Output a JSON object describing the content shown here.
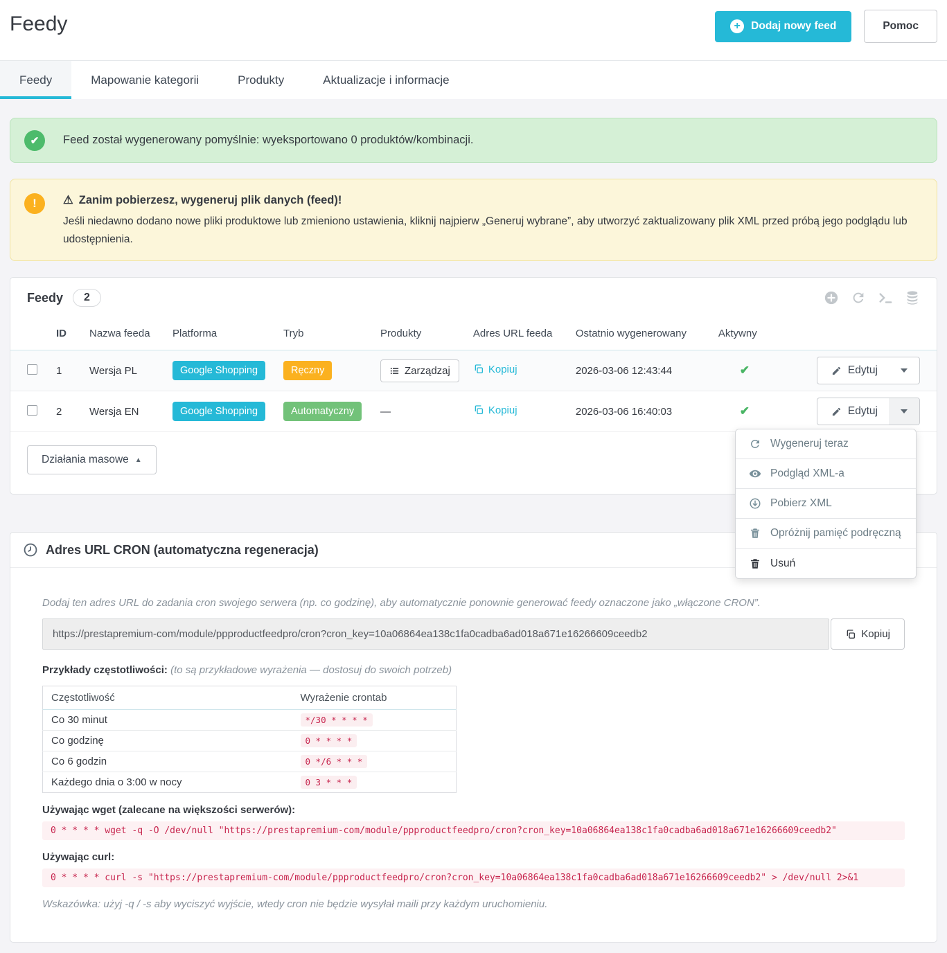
{
  "header": {
    "title": "Feedy",
    "add_button": "Dodaj nowy feed",
    "help_button": "Pomoc"
  },
  "tabs": [
    {
      "label": "Feedy"
    },
    {
      "label": "Mapowanie kategorii"
    },
    {
      "label": "Produkty"
    },
    {
      "label": "Aktualizacje i informacje"
    }
  ],
  "alerts": {
    "success": "Feed został wygenerowany pomyślnie: wyeksportowano 0 produktów/kombinacji.",
    "warning_title": "Zanim pobierzesz, wygeneruj plik danych (feed)!",
    "warning_body": "Jeśli niedawno dodano nowe pliki produktowe lub zmieniono ustawienia, kliknij najpierw „Generuj wybrane”, aby utworzyć zaktualizowany plik XML przed próbą jego podglądu lub udostępnienia."
  },
  "feeds_panel": {
    "title": "Feedy",
    "count": "2",
    "columns": [
      "ID",
      "Nazwa feeda",
      "Platforma",
      "Tryb",
      "Produkty",
      "Adres URL feeda",
      "Ostatnio wygenerowany",
      "Aktywny"
    ],
    "rows": [
      {
        "id": "1",
        "name": "Wersja PL",
        "platform": "Google Shopping",
        "mode": "Ręczny",
        "products": "Zarządzaj",
        "url_label": "Kopiuj",
        "generated": "2026-03-06 12:43:44",
        "edit": "Edytuj"
      },
      {
        "id": "2",
        "name": "Wersja EN",
        "platform": "Google Shopping",
        "mode": "Automatyczny",
        "products": "—",
        "url_label": "Kopiuj",
        "generated": "2026-03-06 16:40:03",
        "edit": "Edytuj"
      }
    ],
    "bulk_button": "Działania masowe",
    "dropdown": [
      "Wygeneruj teraz",
      "Podgląd XML-a",
      "Pobierz XML",
      "Opróżnij pamięć podręczną",
      "Usuń"
    ]
  },
  "cron_panel": {
    "title": "Adres URL CRON (automatyczna regeneracja)",
    "intro": "Dodaj ten adres URL do zadania cron swojego serwera (np. co godzinę), aby automatycznie ponownie generować feedy oznaczone jako „włączone CRON”.",
    "url": "https://prestapremium-com/module/ppproductfeedpro/cron?cron_key=10a06864ea138c1fa0cadba6ad018a671e16266609ceedb2",
    "copy_button": "Kopiuj",
    "examples_label": "Przykłady częstotliwości:",
    "examples_note": "(to są przykładowe wyrażenia — dostosuj do swoich potrzeb)",
    "freq_table": {
      "headers": [
        "Częstotliwość",
        "Wyrażenie crontab"
      ],
      "rows": [
        {
          "label": "Co 30 minut",
          "cron": "*/30 * * * *"
        },
        {
          "label": "Co godzinę",
          "cron": "0 * * * *"
        },
        {
          "label": "Co 6 godzin",
          "cron": "0 */6 * * *"
        },
        {
          "label": "Każdego dnia o 3:00 w nocy",
          "cron": "0 3 * * *"
        }
      ]
    },
    "wget_label": "Używając wget (zalecane na większości serwerów):",
    "wget_cmd": "0 * * * * wget -q -O /dev/null \"https://prestapremium-com/module/ppproductfeedpro/cron?cron_key=10a06864ea138c1fa0cadba6ad018a671e16266609ceedb2\"",
    "curl_label": "Używając curl:",
    "curl_cmd": "0 * * * * curl -s \"https://prestapremium-com/module/ppproductfeedpro/cron?cron_key=10a06864ea138c1fa0cadba6ad018a671e16266609ceedb2\" > /dev/null 2>&1",
    "tip": "Wskazówka: użyj -q / -s aby wyciszyć wyjście, wtedy cron nie będzie wysyłał maili przy każdym uruchomieniu."
  },
  "icons": {
    "plus": "+",
    "check": "✔",
    "exclamation": "!",
    "warning_triangle": "⚠",
    "caret_up": "▲"
  },
  "colors": {
    "accent": "#25b9d7",
    "badge_manual": "#fbb11f",
    "badge_auto": "#72c279",
    "success_icon": "#4dbb6b",
    "warning_icon": "#fbb11f",
    "code_text": "#c7254e"
  }
}
